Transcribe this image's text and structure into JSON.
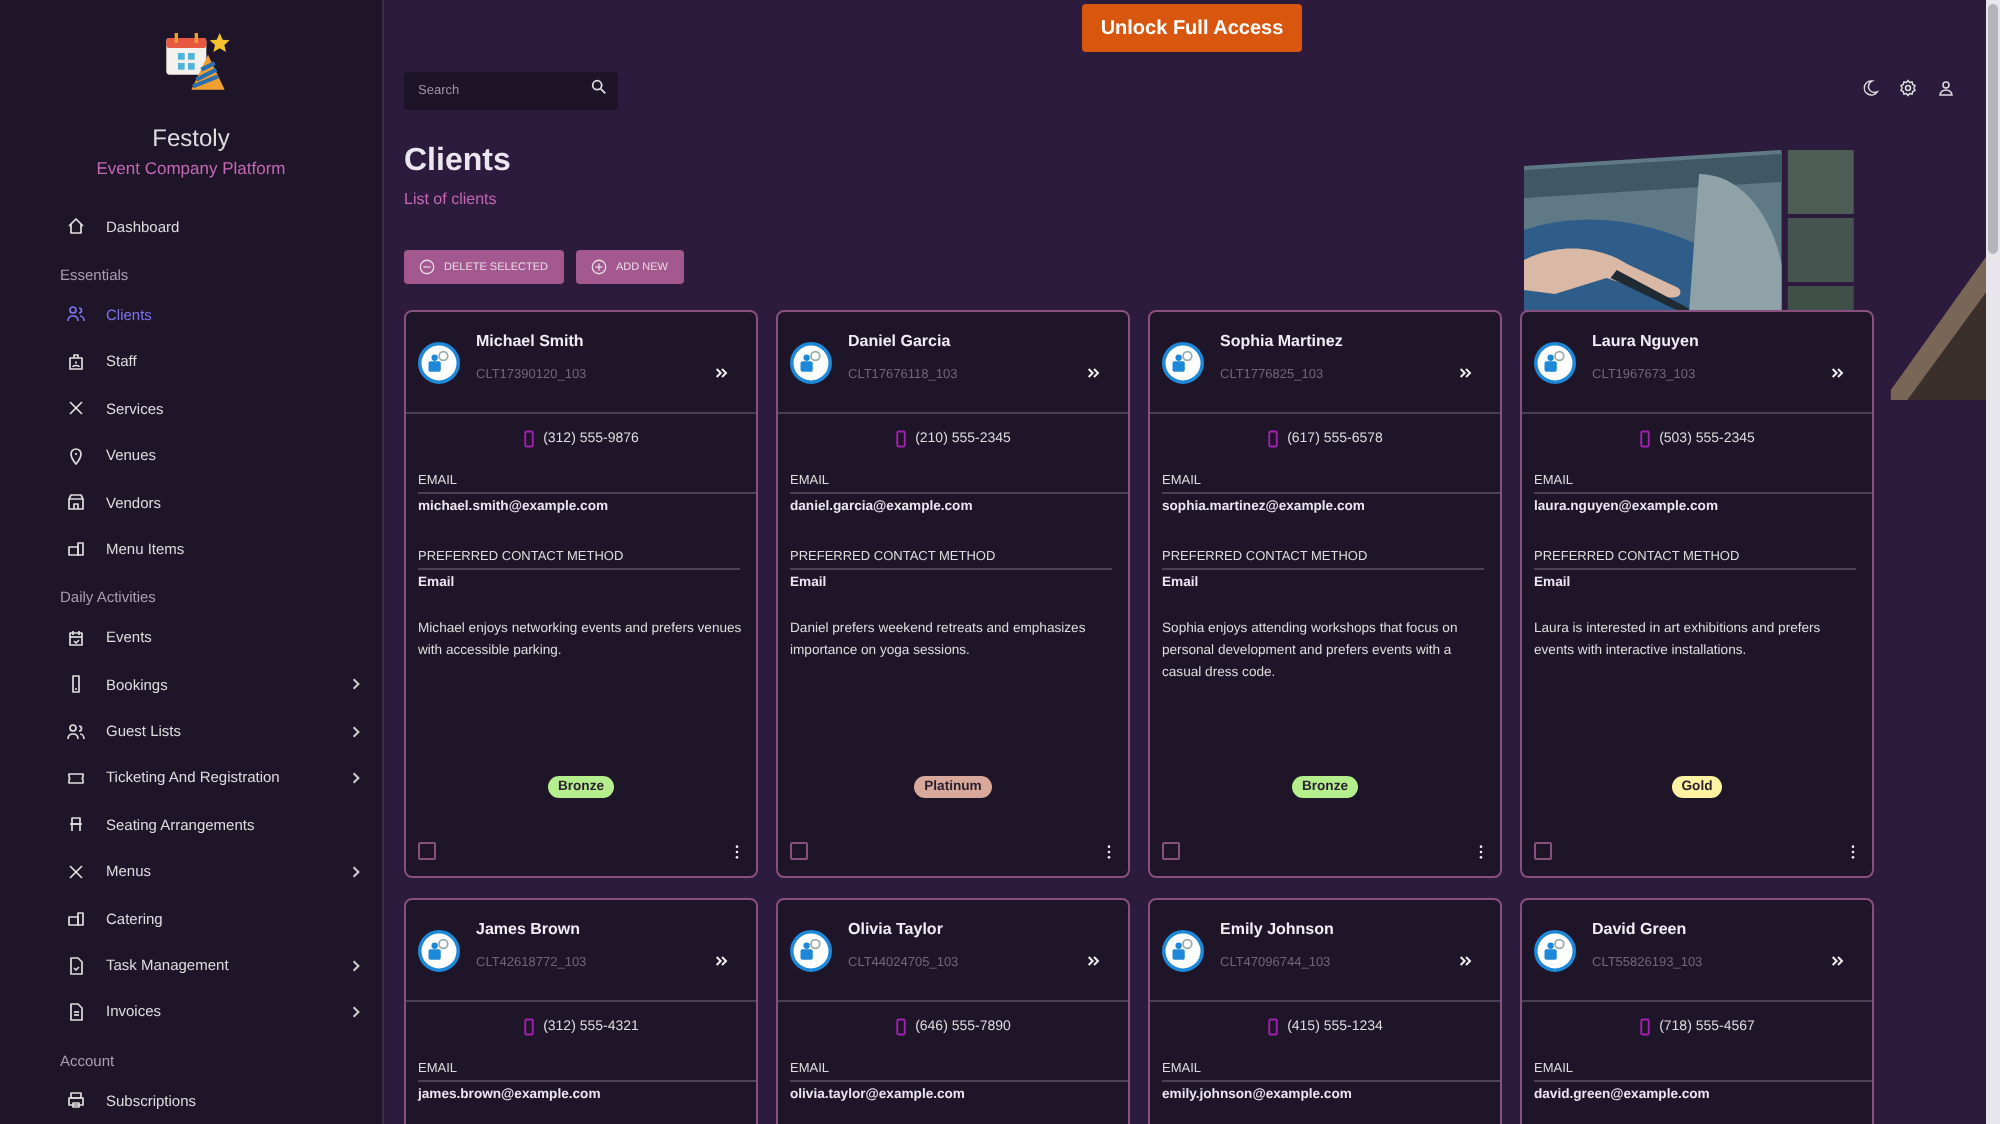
{
  "upgrade_button": {
    "label": "Unlock Full Access"
  },
  "sidebar": {
    "app_name": "Festoly",
    "tagline": "Event Company Platform",
    "sections": [
      {
        "items": [
          {
            "label": "Dashboard",
            "kind": "link",
            "selected": false
          }
        ]
      },
      {
        "title": "Essentials",
        "items": [
          {
            "label": "Clients",
            "kind": "link",
            "selected": true
          },
          {
            "label": "Staff",
            "kind": "link",
            "selected": false
          },
          {
            "label": "Services",
            "kind": "link",
            "selected": false
          },
          {
            "label": "Venues",
            "kind": "link",
            "selected": false
          },
          {
            "label": "Vendors",
            "kind": "link",
            "selected": false
          },
          {
            "label": "Menu Items",
            "kind": "link",
            "selected": false
          }
        ]
      },
      {
        "title": "Daily Activities",
        "items": [
          {
            "label": "Events",
            "kind": "link",
            "selected": false
          },
          {
            "label": "Bookings",
            "kind": "group",
            "selected": false
          },
          {
            "label": "Guest Lists",
            "kind": "group",
            "selected": false
          },
          {
            "label": "Ticketing And Registration",
            "kind": "group",
            "selected": false
          },
          {
            "label": "Seating Arrangements",
            "kind": "link",
            "selected": false
          },
          {
            "label": "Menus",
            "kind": "group",
            "selected": false
          },
          {
            "label": "Catering",
            "kind": "link",
            "selected": false
          },
          {
            "label": "Task Management",
            "kind": "group",
            "selected": false
          },
          {
            "label": "Invoices",
            "kind": "group",
            "selected": false
          }
        ]
      },
      {
        "title": "Account",
        "items": [
          {
            "label": "Subscriptions",
            "kind": "link",
            "selected": false
          }
        ]
      }
    ]
  },
  "search": {
    "placeholder": "Search"
  },
  "page": {
    "title": "Clients",
    "subtitle": "List of clients"
  },
  "actions": [
    {
      "label": "DELETE SELECTED",
      "kind": "remove"
    },
    {
      "label": "ADD NEW",
      "kind": "add"
    }
  ],
  "cards": [
    {
      "name": "Michael Smith",
      "client_id": "CLT17390120_103",
      "phone": "(312) 555-9876",
      "email_label": "EMAIL",
      "email": "michael.smith@example.com",
      "contact_label": "PREFERRED CONTACT METHOD",
      "contact_method": "Email",
      "notes": "Michael enjoys networking events and prefers venues with accessible parking.",
      "tier": {
        "label": "Bronze",
        "color": "#b5ee8c"
      },
      "checked": false
    },
    {
      "name": "Daniel Garcia",
      "client_id": "CLT17676118_103",
      "phone": "(210) 555-2345",
      "email_label": "EMAIL",
      "email": "daniel.garcia@example.com",
      "contact_label": "PREFERRED CONTACT METHOD",
      "contact_method": "Email",
      "notes": "Daniel prefers weekend retreats and emphasizes importance on yoga sessions.",
      "tier": {
        "label": "Platinum",
        "color": "#d8a99a"
      },
      "checked": false
    },
    {
      "name": "Sophia Martinez",
      "client_id": "CLT1776825_103",
      "phone": "(617) 555-6578",
      "email_label": "EMAIL",
      "email": "sophia.martinez@example.com",
      "contact_label": "PREFERRED CONTACT METHOD",
      "contact_method": "Email",
      "notes": "Sophia enjoys attending workshops that focus on personal development and prefers events with a casual dress code.",
      "tier": {
        "label": "Bronze",
        "color": "#b5ee8c"
      },
      "checked": false
    },
    {
      "name": "Laura Nguyen",
      "client_id": "CLT1967673_103",
      "phone": "(503) 555-2345",
      "email_label": "EMAIL",
      "email": "laura.nguyen@example.com",
      "contact_label": "PREFERRED CONTACT METHOD",
      "contact_method": "Email",
      "notes": "Laura is interested in art exhibitions and prefers events with interactive installations.",
      "tier": {
        "label": "Gold",
        "color": "#fff2a0"
      },
      "checked": false
    },
    {
      "name": "James Brown",
      "client_id": "CLT42618772_103",
      "phone": "(312) 555-4321",
      "email_label": "EMAIL",
      "email": "james.brown@example.com"
    },
    {
      "name": "Olivia Taylor",
      "client_id": "CLT44024705_103",
      "phone": "(646) 555-7890",
      "email_label": "EMAIL",
      "email": "olivia.taylor@example.com"
    },
    {
      "name": "Emily Johnson",
      "client_id": "CLT47096744_103",
      "phone": "(415) 555-1234",
      "email_label": "EMAIL",
      "email": "emily.johnson@example.com"
    },
    {
      "name": "David Green",
      "client_id": "CLT55826193_103",
      "phone": "(718) 555-4567",
      "email_label": "EMAIL",
      "email": "david.green@example.com"
    }
  ]
}
